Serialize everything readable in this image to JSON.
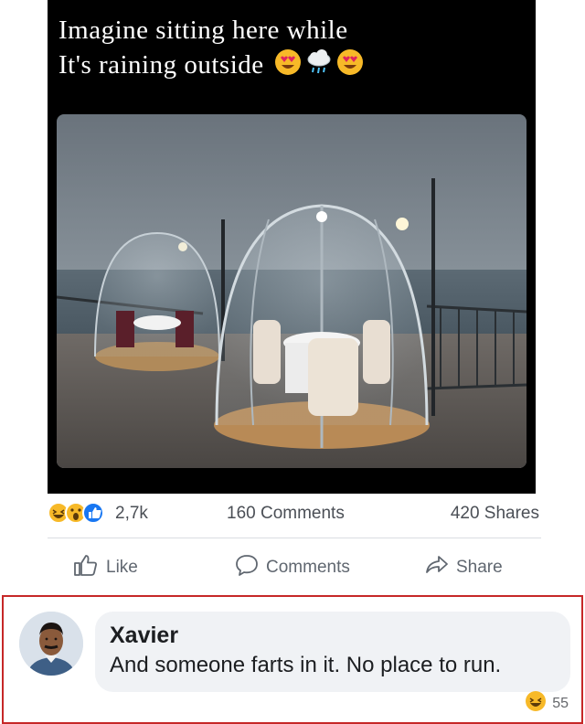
{
  "post": {
    "caption_line1": "Imagine sitting here while",
    "caption_line2": "It's raining outside",
    "caption_emojis": [
      "heart-eyes-emoji",
      "rain-cloud-emoji",
      "heart-eyes-emoji"
    ],
    "photo": "glass-dome-dining-pods"
  },
  "reactions": {
    "icons": [
      "haha-icon",
      "wow-icon",
      "like-icon"
    ],
    "count": "2,7k",
    "comments": "160 Comments",
    "shares": "420 Shares"
  },
  "actions": {
    "like_label": "Like",
    "comment_label": "Comments",
    "share_label": "Share"
  },
  "comment": {
    "author": "Xavier",
    "text": "And someone farts in it. No place to run.",
    "reaction_icon": "haha-icon",
    "reaction_count": "55"
  },
  "colors": {
    "highlight_border": "#c62828",
    "like_blue": "#1877f2",
    "reaction_yellow": "#f7b928",
    "bubble_bg": "#f0f2f5"
  }
}
